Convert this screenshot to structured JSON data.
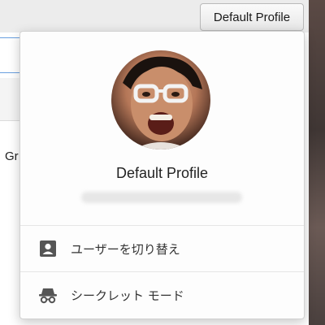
{
  "toolbar": {
    "profile_button_label": "Default Profile"
  },
  "background": {
    "snippet_text": "Gr"
  },
  "profile_menu": {
    "name": "Default Profile",
    "email": "",
    "items": [
      {
        "label": "ユーザーを切り替え",
        "icon": "person-badge-icon"
      },
      {
        "label": "シークレット モード",
        "icon": "incognito-icon"
      }
    ]
  }
}
